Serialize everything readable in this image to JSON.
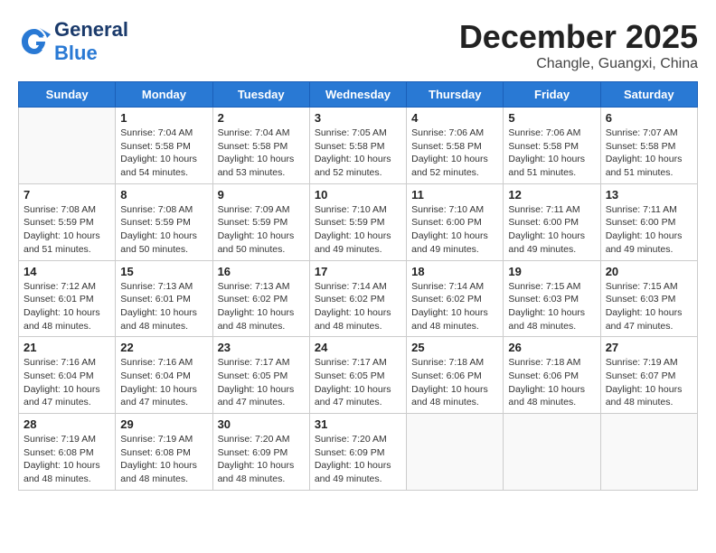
{
  "header": {
    "logo_general": "General",
    "logo_blue": "Blue",
    "month": "December 2025",
    "location": "Changle, Guangxi, China"
  },
  "days_of_week": [
    "Sunday",
    "Monday",
    "Tuesday",
    "Wednesday",
    "Thursday",
    "Friday",
    "Saturday"
  ],
  "weeks": [
    [
      {
        "day": "",
        "info": ""
      },
      {
        "day": "1",
        "info": "Sunrise: 7:04 AM\nSunset: 5:58 PM\nDaylight: 10 hours\nand 54 minutes."
      },
      {
        "day": "2",
        "info": "Sunrise: 7:04 AM\nSunset: 5:58 PM\nDaylight: 10 hours\nand 53 minutes."
      },
      {
        "day": "3",
        "info": "Sunrise: 7:05 AM\nSunset: 5:58 PM\nDaylight: 10 hours\nand 52 minutes."
      },
      {
        "day": "4",
        "info": "Sunrise: 7:06 AM\nSunset: 5:58 PM\nDaylight: 10 hours\nand 52 minutes."
      },
      {
        "day": "5",
        "info": "Sunrise: 7:06 AM\nSunset: 5:58 PM\nDaylight: 10 hours\nand 51 minutes."
      },
      {
        "day": "6",
        "info": "Sunrise: 7:07 AM\nSunset: 5:58 PM\nDaylight: 10 hours\nand 51 minutes."
      }
    ],
    [
      {
        "day": "7",
        "info": "Sunrise: 7:08 AM\nSunset: 5:59 PM\nDaylight: 10 hours\nand 51 minutes."
      },
      {
        "day": "8",
        "info": "Sunrise: 7:08 AM\nSunset: 5:59 PM\nDaylight: 10 hours\nand 50 minutes."
      },
      {
        "day": "9",
        "info": "Sunrise: 7:09 AM\nSunset: 5:59 PM\nDaylight: 10 hours\nand 50 minutes."
      },
      {
        "day": "10",
        "info": "Sunrise: 7:10 AM\nSunset: 5:59 PM\nDaylight: 10 hours\nand 49 minutes."
      },
      {
        "day": "11",
        "info": "Sunrise: 7:10 AM\nSunset: 6:00 PM\nDaylight: 10 hours\nand 49 minutes."
      },
      {
        "day": "12",
        "info": "Sunrise: 7:11 AM\nSunset: 6:00 PM\nDaylight: 10 hours\nand 49 minutes."
      },
      {
        "day": "13",
        "info": "Sunrise: 7:11 AM\nSunset: 6:00 PM\nDaylight: 10 hours\nand 49 minutes."
      }
    ],
    [
      {
        "day": "14",
        "info": "Sunrise: 7:12 AM\nSunset: 6:01 PM\nDaylight: 10 hours\nand 48 minutes."
      },
      {
        "day": "15",
        "info": "Sunrise: 7:13 AM\nSunset: 6:01 PM\nDaylight: 10 hours\nand 48 minutes."
      },
      {
        "day": "16",
        "info": "Sunrise: 7:13 AM\nSunset: 6:02 PM\nDaylight: 10 hours\nand 48 minutes."
      },
      {
        "day": "17",
        "info": "Sunrise: 7:14 AM\nSunset: 6:02 PM\nDaylight: 10 hours\nand 48 minutes."
      },
      {
        "day": "18",
        "info": "Sunrise: 7:14 AM\nSunset: 6:02 PM\nDaylight: 10 hours\nand 48 minutes."
      },
      {
        "day": "19",
        "info": "Sunrise: 7:15 AM\nSunset: 6:03 PM\nDaylight: 10 hours\nand 48 minutes."
      },
      {
        "day": "20",
        "info": "Sunrise: 7:15 AM\nSunset: 6:03 PM\nDaylight: 10 hours\nand 47 minutes."
      }
    ],
    [
      {
        "day": "21",
        "info": "Sunrise: 7:16 AM\nSunset: 6:04 PM\nDaylight: 10 hours\nand 47 minutes."
      },
      {
        "day": "22",
        "info": "Sunrise: 7:16 AM\nSunset: 6:04 PM\nDaylight: 10 hours\nand 47 minutes."
      },
      {
        "day": "23",
        "info": "Sunrise: 7:17 AM\nSunset: 6:05 PM\nDaylight: 10 hours\nand 47 minutes."
      },
      {
        "day": "24",
        "info": "Sunrise: 7:17 AM\nSunset: 6:05 PM\nDaylight: 10 hours\nand 47 minutes."
      },
      {
        "day": "25",
        "info": "Sunrise: 7:18 AM\nSunset: 6:06 PM\nDaylight: 10 hours\nand 48 minutes."
      },
      {
        "day": "26",
        "info": "Sunrise: 7:18 AM\nSunset: 6:06 PM\nDaylight: 10 hours\nand 48 minutes."
      },
      {
        "day": "27",
        "info": "Sunrise: 7:19 AM\nSunset: 6:07 PM\nDaylight: 10 hours\nand 48 minutes."
      }
    ],
    [
      {
        "day": "28",
        "info": "Sunrise: 7:19 AM\nSunset: 6:08 PM\nDaylight: 10 hours\nand 48 minutes."
      },
      {
        "day": "29",
        "info": "Sunrise: 7:19 AM\nSunset: 6:08 PM\nDaylight: 10 hours\nand 48 minutes."
      },
      {
        "day": "30",
        "info": "Sunrise: 7:20 AM\nSunset: 6:09 PM\nDaylight: 10 hours\nand 48 minutes."
      },
      {
        "day": "31",
        "info": "Sunrise: 7:20 AM\nSunset: 6:09 PM\nDaylight: 10 hours\nand 49 minutes."
      },
      {
        "day": "",
        "info": ""
      },
      {
        "day": "",
        "info": ""
      },
      {
        "day": "",
        "info": ""
      }
    ]
  ]
}
